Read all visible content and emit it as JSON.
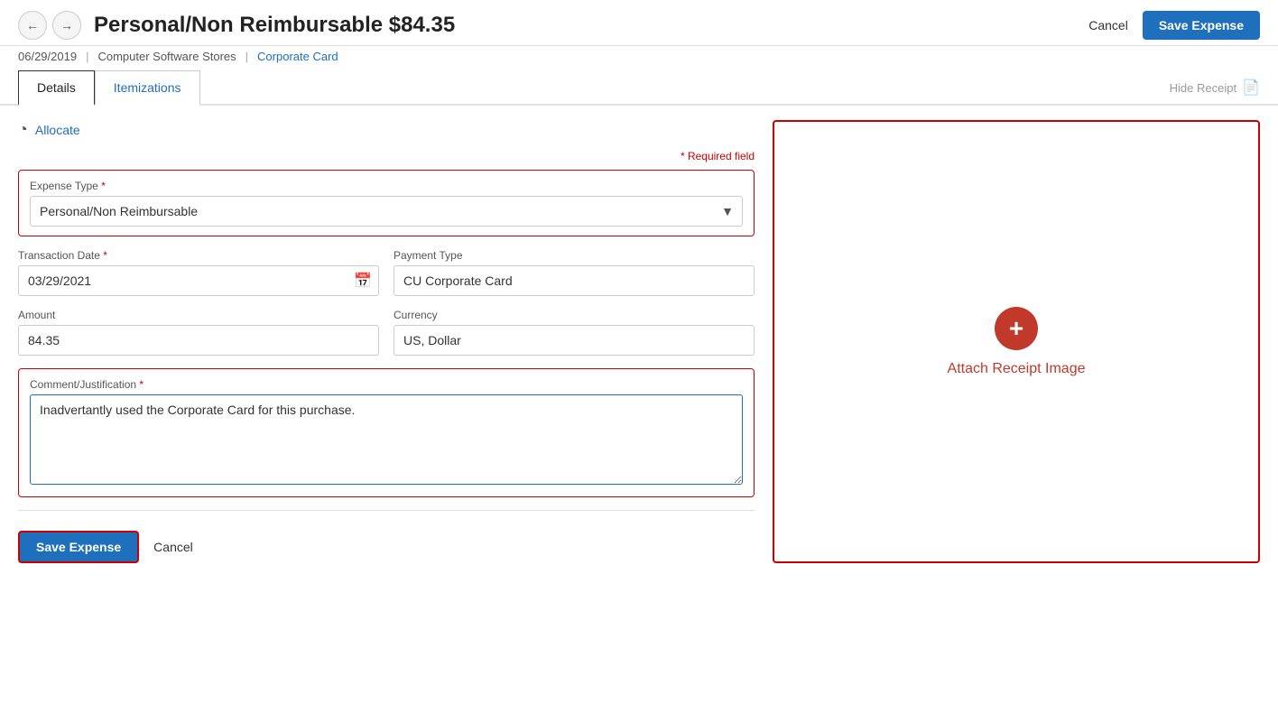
{
  "header": {
    "title": "Personal/Non Reimbursable $84.35",
    "date": "06/29/2019",
    "store": "Computer Software Stores",
    "card": "Corporate Card",
    "cancel_label": "Cancel",
    "save_label": "Save Expense"
  },
  "tabs": {
    "details_label": "Details",
    "itemizations_label": "Itemizations",
    "hide_receipt_label": "Hide Receipt"
  },
  "form": {
    "allocate_label": "Allocate",
    "required_notice": "* Required field",
    "expense_type_label": "Expense Type",
    "expense_type_required": "*",
    "expense_type_value": "Personal/Non Reimbursable",
    "transaction_date_label": "Transaction Date",
    "transaction_date_required": "*",
    "transaction_date_value": "03/29/2021",
    "payment_type_label": "Payment Type",
    "payment_type_value": "CU Corporate Card",
    "amount_label": "Amount",
    "amount_value": "84.35",
    "currency_label": "Currency",
    "currency_value": "US, Dollar",
    "comment_label": "Comment/Justification",
    "comment_required": "*",
    "comment_value": "Inadvertantly used the Corporate Card for this purchase.",
    "save_bottom_label": "Save Expense",
    "cancel_bottom_label": "Cancel"
  },
  "receipt": {
    "attach_label": "Attach Receipt Image",
    "plus_icon": "+"
  }
}
